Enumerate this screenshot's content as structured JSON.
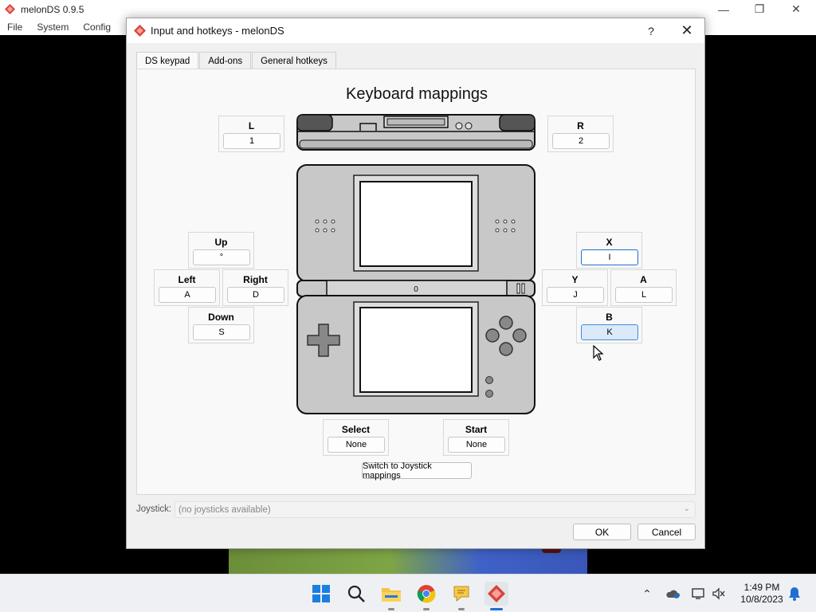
{
  "app": {
    "title": "melonDS 0.9.5",
    "menu": [
      "File",
      "System",
      "Config"
    ]
  },
  "dialog": {
    "title": "Input and hotkeys - melonDS",
    "help": "?",
    "tabs": [
      "DS keypad",
      "Add-ons",
      "General hotkeys"
    ],
    "active_tab": "DS keypad",
    "heading": "Keyboard mappings",
    "mappings": {
      "L": {
        "label": "L",
        "key": "1"
      },
      "R": {
        "label": "R",
        "key": "2"
      },
      "Up": {
        "label": "Up",
        "key": "°"
      },
      "Left": {
        "label": "Left",
        "key": "A"
      },
      "Right": {
        "label": "Right",
        "key": "D"
      },
      "Down": {
        "label": "Down",
        "key": "S"
      },
      "X": {
        "label": "X",
        "key": "I"
      },
      "Y": {
        "label": "Y",
        "key": "J"
      },
      "A": {
        "label": "A",
        "key": "L"
      },
      "B": {
        "label": "B",
        "key": "K"
      },
      "Select": {
        "label": "Select",
        "key": "None"
      },
      "Start": {
        "label": "Start",
        "key": "None"
      }
    },
    "ds_hinge_label": "0",
    "switch_button": "Switch to Joystick mappings",
    "joystick_label": "Joystick:",
    "joystick_value": "(no joysticks available)",
    "ok": "OK",
    "cancel": "Cancel"
  },
  "taskbar": {
    "time": "1:49 PM",
    "date": "10/8/2023",
    "apps": [
      "start-icon",
      "search-icon",
      "file-explorer-icon",
      "chrome-icon",
      "notes-icon",
      "melonds-icon"
    ]
  },
  "colors": {
    "accent": "#1f6fd1",
    "hover": "#dbe9f8",
    "ds_body": "#c8c8c8",
    "app_icon": "#d9433a"
  }
}
